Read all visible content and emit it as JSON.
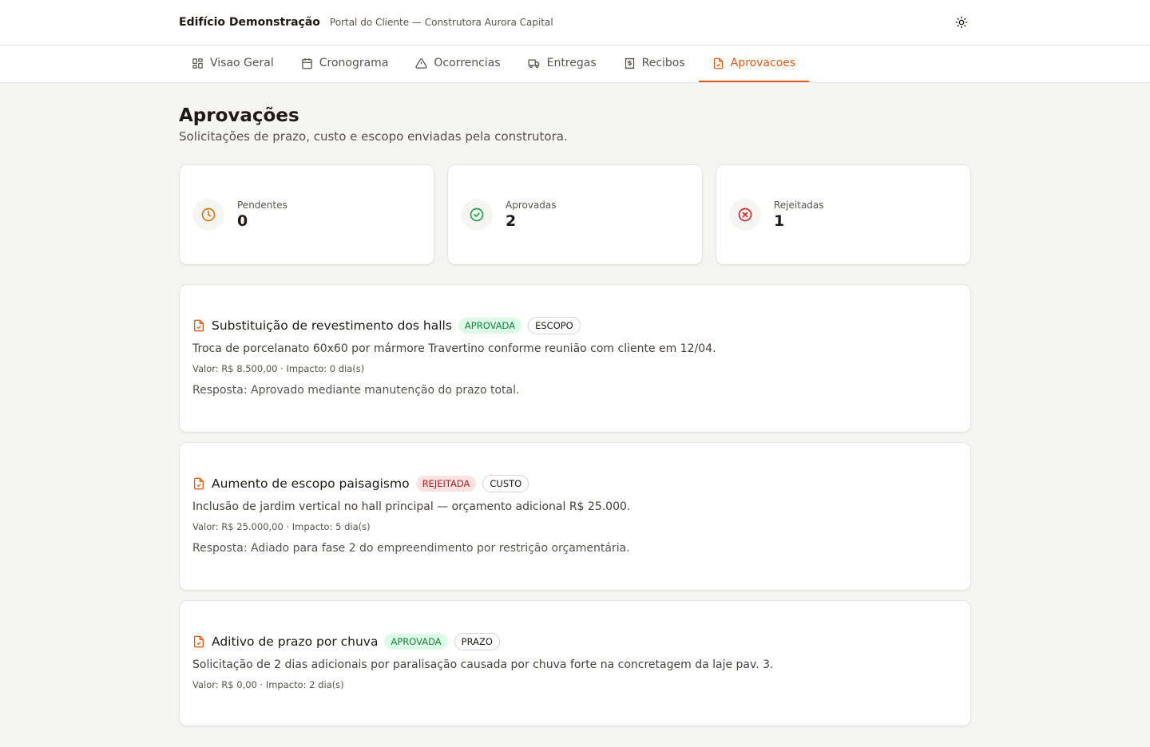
{
  "header": {
    "title": "Edifício Demonstração",
    "subtitle": "Portal do Cliente — Construtora Aurora Capital",
    "theme_icon": "sun-icon"
  },
  "nav": {
    "items": [
      {
        "label": "Visao Geral",
        "icon": "grid-icon"
      },
      {
        "label": "Cronograma",
        "icon": "calendar-icon"
      },
      {
        "label": "Ocorrencias",
        "icon": "alert-triangle-icon"
      },
      {
        "label": "Entregas",
        "icon": "truck-icon"
      },
      {
        "label": "Recibos",
        "icon": "receipt-icon"
      },
      {
        "label": "Aprovacoes",
        "icon": "file-check-icon",
        "active": true
      }
    ],
    "accent": "#ea580c"
  },
  "page": {
    "title": "Aprovações",
    "subtitle": "Solicitações de prazo, custo e escopo enviadas pela construtora."
  },
  "stats": [
    {
      "label": "Pendentes",
      "value": "0",
      "icon": "clock-icon",
      "color": "#d97706"
    },
    {
      "label": "Aprovadas",
      "value": "2",
      "icon": "check-circle-icon",
      "color": "#16a34a"
    },
    {
      "label": "Rejeitadas",
      "value": "1",
      "icon": "x-circle-icon",
      "color": "#dc2626"
    }
  ],
  "approvals": [
    {
      "title": "Substituição de revestimento dos halls",
      "status": "APROVADA",
      "type": "ESCOPO",
      "description": "Troca de porcelanato 60x60 por mármore Travertino conforme reunião com cliente em 12/04.",
      "meta": "Valor: R$ 8.500,00 · Impacto: 0 dia(s)",
      "response": "Resposta: Aprovado mediante manutenção do prazo total."
    },
    {
      "title": "Aumento de escopo paisagismo",
      "status": "REJEITADA",
      "type": "CUSTO",
      "description": "Inclusão de jardim vertical no hall principal — orçamento adicional R$ 25.000.",
      "meta": "Valor: R$ 25.000,00 · Impacto: 5 dia(s)",
      "response": "Resposta: Adiado para fase 2 do empreendimento por restrição orçamentária."
    },
    {
      "title": "Aditivo de prazo por chuva",
      "status": "APROVADA",
      "type": "PRAZO",
      "description": "Solicitação de 2 dias adicionais por paralisação causada por chuva forte na concretagem da laje pav. 3.",
      "meta": "Valor: R$ 0,00 · Impacto: 2 dia(s)"
    }
  ]
}
